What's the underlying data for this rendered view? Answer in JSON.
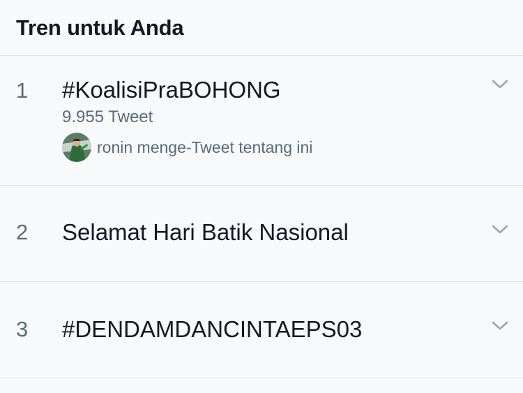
{
  "header": {
    "title": "Tren untuk Anda"
  },
  "trends": [
    {
      "rank": "1",
      "name": "#KoalisiPraBOHONG",
      "tweet_count": "9.955 Tweet",
      "context": "ronin menge-Tweet tentang ini",
      "avatar_icon": "user-avatar"
    },
    {
      "rank": "2",
      "name": "Selamat Hari Batik Nasional"
    },
    {
      "rank": "3",
      "name": "#DENDAMDANCINTAEPS03"
    }
  ],
  "icons": {
    "more": "chevron-down-icon"
  },
  "colors": {
    "background": "#f7f9fa",
    "primary_text": "#141823",
    "secondary_text": "#5b6b7a",
    "divider": "#e1e5e9",
    "chevron": "#9aa7b3"
  }
}
